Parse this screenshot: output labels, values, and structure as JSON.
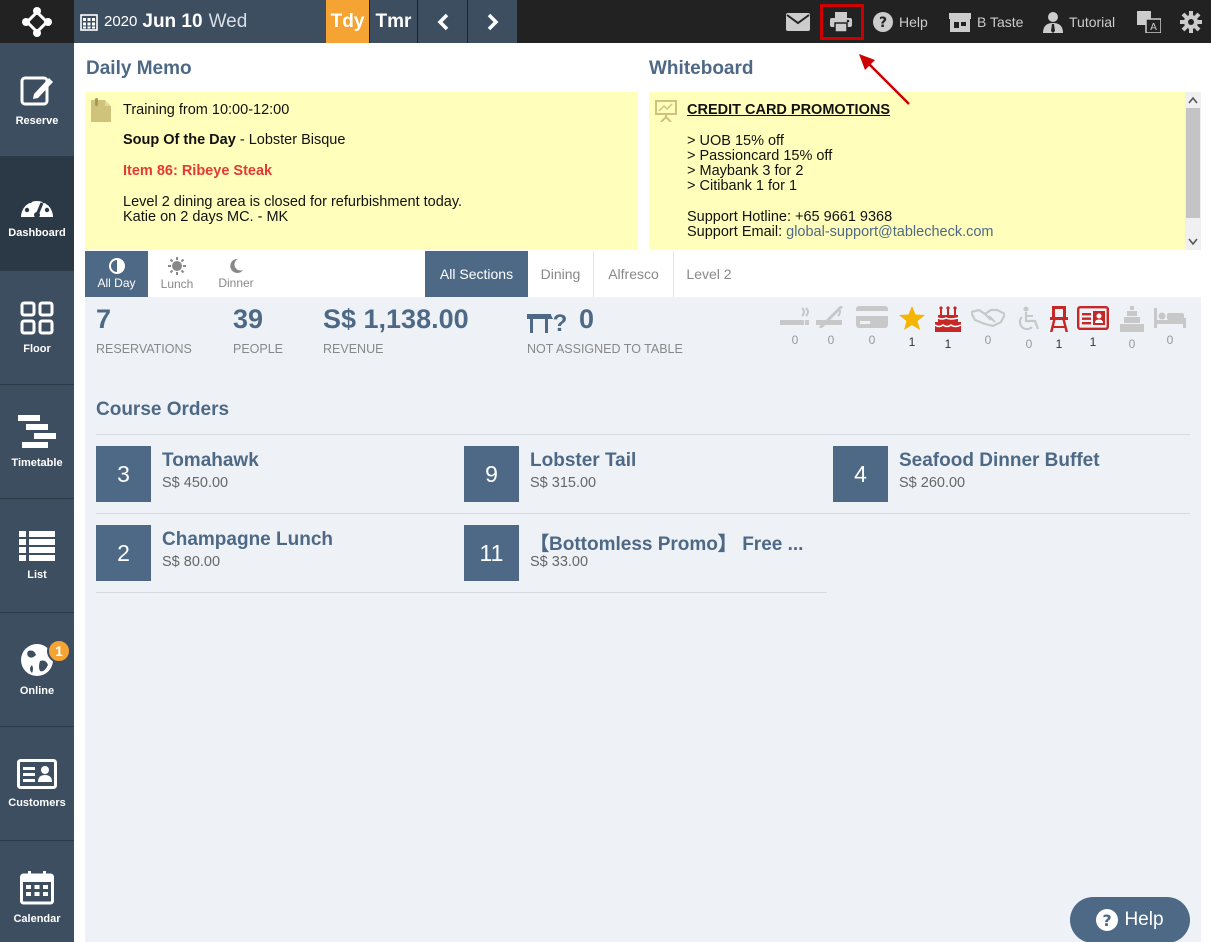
{
  "topbar": {
    "year": "2020",
    "month_day": "Jun 10",
    "weekday": "Wed",
    "today_label": "Tdy",
    "tomorrow_label": "Tmr",
    "help_label": "Help",
    "shop_label": "B Taste",
    "tutorial_label": "Tutorial"
  },
  "sidebar": {
    "items": [
      {
        "label": "Reserve"
      },
      {
        "label": "Dashboard"
      },
      {
        "label": "Floor"
      },
      {
        "label": "Timetable"
      },
      {
        "label": "List"
      },
      {
        "label": "Online",
        "badge": "1"
      },
      {
        "label": "Customers"
      },
      {
        "label": "Calendar"
      }
    ]
  },
  "memo": {
    "title": "Daily Memo",
    "line1": "Training from 10:00-12:00",
    "soup_label": "Soup Of the Day",
    "soup_sep": " - ",
    "soup_value": "Lobster Bisque",
    "item86": "Item 86: Ribeye Steak",
    "line4": "Level 2 dining area is closed for refurbishment today.",
    "line5": "Katie on 2 days MC. - MK"
  },
  "whiteboard": {
    "title": "Whiteboard",
    "heading": "CREDIT CARD PROMOTIONS",
    "promos": [
      "> UOB 15% off",
      "> Passioncard 15% off",
      "> Maybank 3 for 2",
      "> Citibank 1 for 1"
    ],
    "hotline": "Support Hotline: +65 9661 9368",
    "email_label": "Support Email: ",
    "email": "global-support@tablecheck.com"
  },
  "meal_tabs": [
    {
      "label": "All Day"
    },
    {
      "label": "Lunch"
    },
    {
      "label": "Dinner"
    }
  ],
  "section_tabs": [
    {
      "label": "All Sections"
    },
    {
      "label": "Dining"
    },
    {
      "label": "Alfresco"
    },
    {
      "label": "Level 2"
    }
  ],
  "stats": {
    "reservations": {
      "value": "7",
      "label": "RESERVATIONS"
    },
    "people": {
      "value": "39",
      "label": "PEOPLE"
    },
    "revenue": {
      "value": "S$ 1,138.00",
      "label": "REVENUE"
    },
    "unassigned": {
      "value": "0",
      "label": "NOT ASSIGNED TO TABLE"
    }
  },
  "flags": [
    {
      "icon": "smoking-icon",
      "count": "0",
      "color": "#c8c8c8"
    },
    {
      "icon": "no-smoking-icon",
      "count": "0",
      "color": "#c8c8c8"
    },
    {
      "icon": "credit-card-icon",
      "count": "0",
      "color": "#c8c8c8"
    },
    {
      "icon": "star-icon",
      "count": "1",
      "color": "#f5b400"
    },
    {
      "icon": "birthday-cake-icon",
      "count": "1",
      "color": "#c62828"
    },
    {
      "icon": "handshake-icon",
      "count": "0",
      "color": "#c8c8c8"
    },
    {
      "icon": "wheelchair-icon",
      "count": "0",
      "color": "#c8c8c8"
    },
    {
      "icon": "high-chair-icon",
      "count": "1",
      "color": "#c62828"
    },
    {
      "icon": "id-card-icon",
      "count": "1",
      "color": "#c62828"
    },
    {
      "icon": "wedding-cake-icon",
      "count": "0",
      "color": "#c8c8c8"
    },
    {
      "icon": "bed-icon",
      "count": "0",
      "color": "#c8c8c8"
    }
  ],
  "course_orders": {
    "title": "Course Orders",
    "items": [
      {
        "qty": "3",
        "name": "Tomahawk",
        "price": "S$ 450.00"
      },
      {
        "qty": "9",
        "name": "Lobster Tail",
        "price": "S$ 315.00"
      },
      {
        "qty": "4",
        "name": "Seafood Dinner Buffet",
        "price": "S$ 260.00"
      },
      {
        "qty": "2",
        "name": "Champagne Lunch",
        "price": "S$ 80.00"
      },
      {
        "qty": "11",
        "name": "【Bottomless Promo】 Free ...",
        "price": "S$ 33.00"
      }
    ]
  },
  "help_button": {
    "label": "Help"
  },
  "colors": {
    "accent": "#f5a333",
    "primary": "#4e6985",
    "highlight": "#c00000"
  }
}
